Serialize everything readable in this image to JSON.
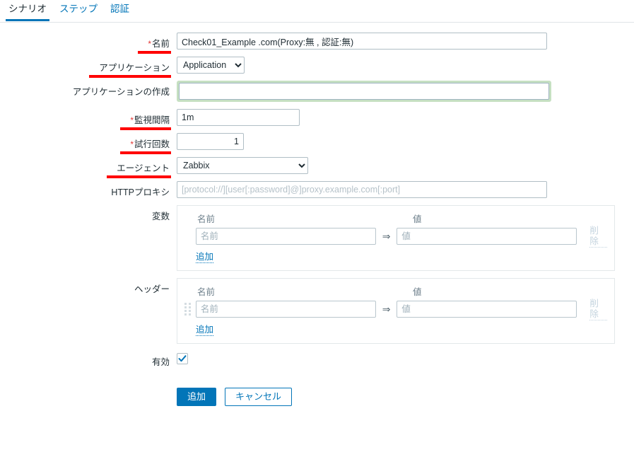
{
  "tabs": [
    {
      "label": "シナリオ",
      "active": true
    },
    {
      "label": "ステップ",
      "active": false
    },
    {
      "label": "認証",
      "active": false
    }
  ],
  "form": {
    "name": {
      "label": "名前",
      "required": true,
      "value": "Check01_Example .com(Proxy:無 , 認証:無)",
      "placeholder": ""
    },
    "application": {
      "label": "アプリケーション",
      "selected": "Application",
      "options": [
        "Application"
      ]
    },
    "new_application": {
      "label": "アプリケーションの作成",
      "value": "",
      "placeholder": ""
    },
    "interval": {
      "label": "監視間隔",
      "required": true,
      "value": "1m"
    },
    "attempts": {
      "label": "試行回数",
      "required": true,
      "value": "1"
    },
    "agent": {
      "label": "エージェント",
      "selected": "Zabbix",
      "options": [
        "Zabbix"
      ]
    },
    "http_proxy": {
      "label": "HTTPプロキシ",
      "value": "",
      "placeholder": "[protocol://][user[:password]@]proxy.example.com[:port]"
    },
    "variables": {
      "label": "変数",
      "columns": {
        "name": "名前",
        "value": "値"
      },
      "rows": [
        {
          "name": "",
          "name_placeholder": "名前",
          "value": "",
          "value_placeholder": "値",
          "arrow": "⇒",
          "remove_label": "削除"
        }
      ],
      "add_label": "追加"
    },
    "headers": {
      "label": "ヘッダー",
      "columns": {
        "name": "名前",
        "value": "値"
      },
      "rows": [
        {
          "name": "",
          "name_placeholder": "名前",
          "value": "",
          "value_placeholder": "値",
          "arrow": "⇒",
          "remove_label": "削除"
        }
      ],
      "add_label": "追加"
    },
    "enabled": {
      "label": "有効",
      "checked": true
    }
  },
  "footer": {
    "submit_label": "追加",
    "cancel_label": "キャンセル"
  },
  "colors": {
    "accent": "#0275b8",
    "required_star": "#e33734",
    "annotation_underline": "#ff0000",
    "focus_ring": "#c6e0c2",
    "disabled_link": "#c3d3de"
  }
}
